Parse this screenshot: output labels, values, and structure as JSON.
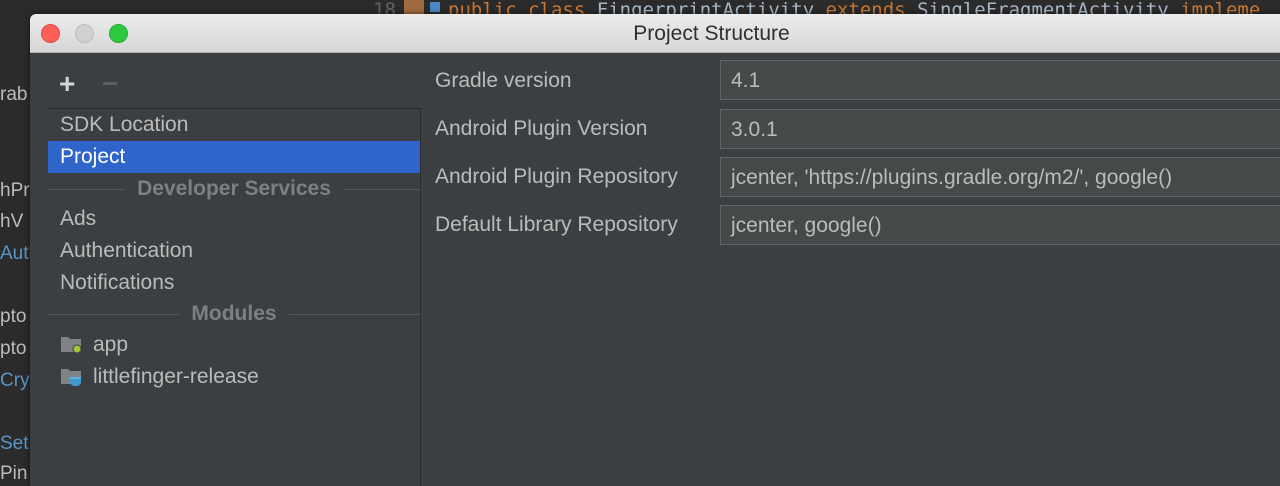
{
  "background_ide": {
    "line_number": "18",
    "code_keyword_public": "public",
    "code_keyword_class": "class",
    "code_class_name": "FingerprintActivity",
    "code_keyword_extends": "extends",
    "code_parent": "SingleFragmentActivity",
    "code_keyword_implements": "impleme",
    "left_fragments": [
      "rab",
      "hPr",
      "hV",
      "Auth",
      "pto",
      "pto",
      "Cryp",
      "SetP",
      "Pin"
    ]
  },
  "window": {
    "title": "Project Structure"
  },
  "toolbar": {
    "add_label": "+",
    "remove_label": "−"
  },
  "sidebar": {
    "items": [
      {
        "label": "SDK Location"
      },
      {
        "label": "Project"
      }
    ],
    "developer_services_header": "Developer Services",
    "services": [
      {
        "label": "Ads"
      },
      {
        "label": "Authentication"
      },
      {
        "label": "Notifications"
      }
    ],
    "modules_header": "Modules",
    "modules": [
      {
        "label": "app"
      },
      {
        "label": "littlefinger-release"
      }
    ]
  },
  "project_settings": {
    "gradle_version_label": "Gradle version",
    "gradle_version_value": "4.1",
    "android_plugin_version_label": "Android Plugin Version",
    "android_plugin_version_value": "3.0.1",
    "android_plugin_repository_label": "Android Plugin Repository",
    "android_plugin_repository_value": "jcenter, 'https://plugins.gradle.org/m2/', google()",
    "default_library_repository_label": "Default Library Repository",
    "default_library_repository_value": "jcenter, google()"
  },
  "colors": {
    "selection": "#2f65ca",
    "panel": "#3c3f41",
    "text": "#bbbbbb"
  }
}
